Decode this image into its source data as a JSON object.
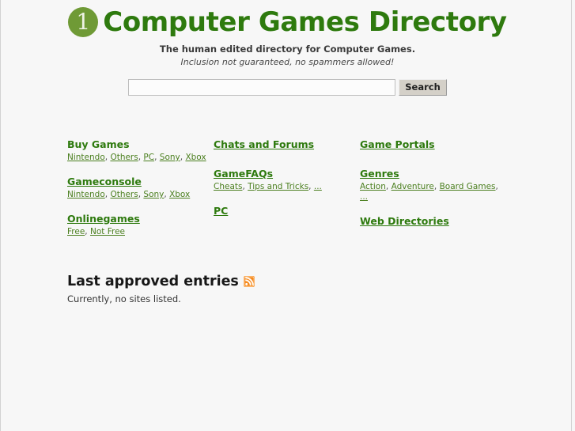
{
  "colors": {
    "brand_green": "#2e7a0e",
    "logo_circle": "#6f9a36",
    "link_green": "#4b7f1f",
    "rss_orange": "#f58a1f",
    "page_background": "#f7f7f7"
  },
  "header": {
    "logo_text": "1",
    "logo_icon": "number-one-circle-icon",
    "title": "Computer Games Directory",
    "tagline": "The human edited directory for Computer Games.",
    "subtagline": "Inclusion not guaranteed, no spammers allowed!"
  },
  "search": {
    "value": "",
    "placeholder": "",
    "button_label": "Search"
  },
  "categories": [
    {
      "column": 1,
      "blocks": [
        {
          "heading": "Buy Games",
          "underlined": false,
          "links": [
            "Nintendo",
            "Others",
            "PC",
            "Sony",
            "Xbox"
          ]
        },
        {
          "heading": "Gameconsole",
          "underlined": true,
          "links": [
            "Nintendo",
            "Others",
            "Sony",
            "Xbox"
          ]
        },
        {
          "heading": "Onlinegames",
          "underlined": true,
          "links": [
            "Free",
            "Not Free"
          ]
        }
      ]
    },
    {
      "column": 2,
      "blocks": [
        {
          "heading": "Chats and Forums",
          "underlined": true,
          "links": []
        },
        {
          "heading": "GameFAQs",
          "underlined": true,
          "links": [
            "Cheats",
            "Tips and Tricks",
            "..."
          ]
        },
        {
          "heading": "PC",
          "underlined": true,
          "links": []
        }
      ]
    },
    {
      "column": 3,
      "blocks": [
        {
          "heading": "Game Portals",
          "underlined": true,
          "links": []
        },
        {
          "heading": "Genres",
          "underlined": true,
          "links": [
            "Action",
            "Adventure",
            "Board Games",
            "..."
          ]
        },
        {
          "heading": "Web Directories",
          "underlined": true,
          "links": []
        }
      ]
    }
  ],
  "last_approved": {
    "heading": "Last approved entries",
    "rss_icon": "rss-feed-icon",
    "note": "Currently, no sites listed."
  }
}
